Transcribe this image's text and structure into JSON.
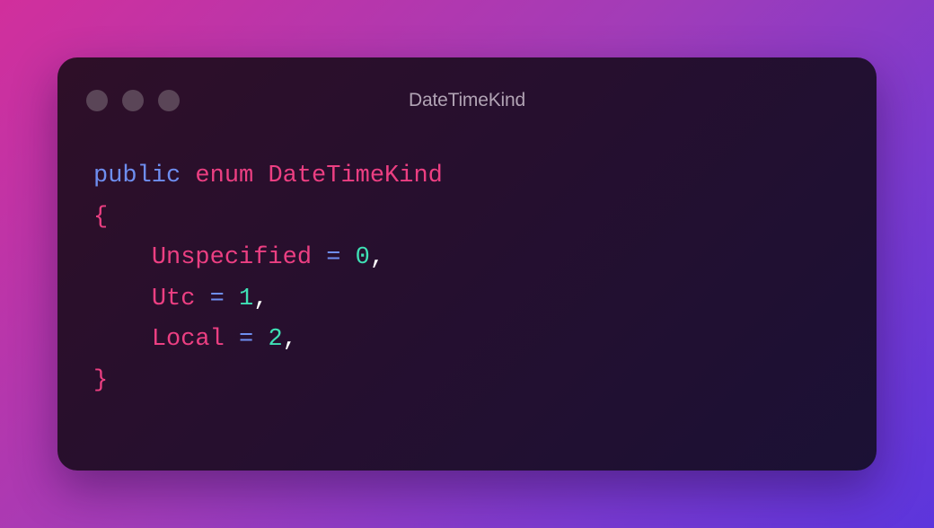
{
  "window": {
    "title": "DateTimeKind",
    "controls": [
      "close",
      "minimize",
      "maximize"
    ]
  },
  "code": {
    "language": "C#",
    "line1": {
      "kw_public": "public",
      "kw_enum": "enum",
      "type_name": "DateTimeKind"
    },
    "open_brace": "{",
    "members": [
      {
        "name": "Unspecified",
        "op": "=",
        "value": "0",
        "sep": ","
      },
      {
        "name": "Utc",
        "op": "=",
        "value": "1",
        "sep": ","
      },
      {
        "name": "Local",
        "op": "=",
        "value": "2",
        "sep": ","
      }
    ],
    "close_brace": "}"
  },
  "colors": {
    "keyword_blue": "#6e8ef0",
    "identifier_pink": "#ec3f82",
    "number_teal": "#3fe0b5",
    "title_gray": "#b1a3b4",
    "window_bg": "#250f2f"
  }
}
